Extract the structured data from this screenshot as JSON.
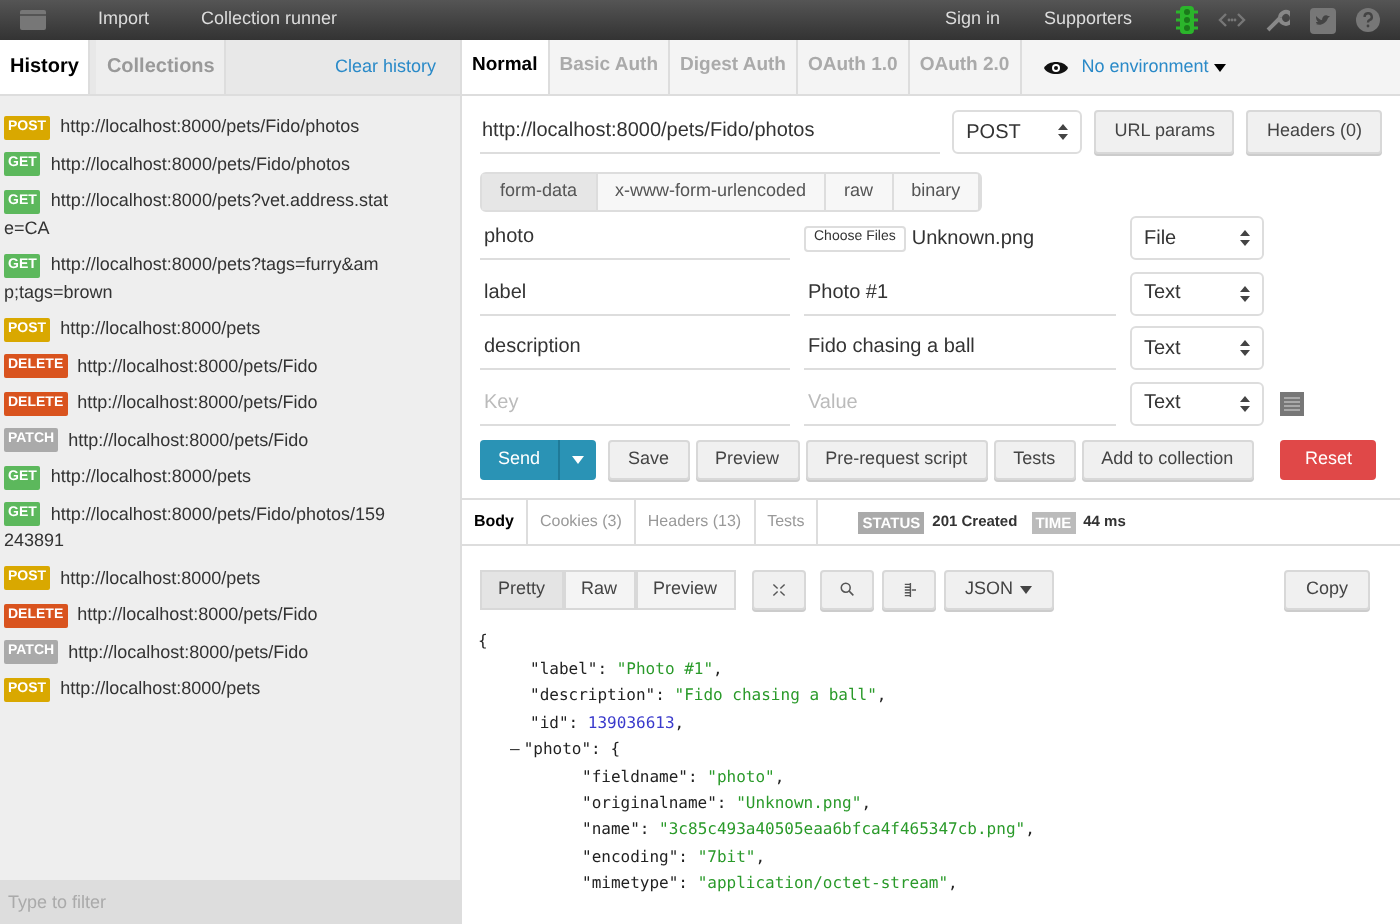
{
  "top_bar": {
    "menu": [
      "Import",
      "Collection runner"
    ],
    "right_links": [
      "Sign in",
      "Supporters"
    ]
  },
  "sidebar": {
    "tabs": [
      {
        "label": "History",
        "selected": true
      },
      {
        "label": "Collections",
        "selected": false
      }
    ],
    "clear_link": "Clear history",
    "history": [
      {
        "method": "POST",
        "color": "#d9a800",
        "url": "http://localhost:8000/pets/Fido/photos"
      },
      {
        "method": "GET",
        "color": "#5cb85c",
        "url": "http://localhost:8000/pets/Fido/photos"
      },
      {
        "method": "GET",
        "color": "#5cb85c",
        "url": "http://localhost:8000/pets?vet.address.state=CA"
      },
      {
        "method": "GET",
        "color": "#5cb85c",
        "url": "http://localhost:8000/pets?tags=furry&amp;tags=brown"
      },
      {
        "method": "POST",
        "color": "#d9a800",
        "url": "http://localhost:8000/pets"
      },
      {
        "method": "DELETE",
        "color": "#d9531e",
        "url": "http://localhost:8000/pets/Fido"
      },
      {
        "method": "DELETE",
        "color": "#d9531e",
        "url": "http://localhost:8000/pets/Fido"
      },
      {
        "method": "PATCH",
        "color": "#aaaaaa",
        "url": "http://localhost:8000/pets/Fido"
      },
      {
        "method": "GET",
        "color": "#5cb85c",
        "url": "http://localhost:8000/pets"
      },
      {
        "method": "GET",
        "color": "#5cb85c",
        "url": "http://localhost:8000/pets/Fido/photos/159243891"
      },
      {
        "method": "POST",
        "color": "#d9a800",
        "url": "http://localhost:8000/pets"
      },
      {
        "method": "DELETE",
        "color": "#d9531e",
        "url": "http://localhost:8000/pets/Fido"
      },
      {
        "method": "PATCH",
        "color": "#aaaaaa",
        "url": "http://localhost:8000/pets/Fido"
      },
      {
        "method": "POST",
        "color": "#d9a800",
        "url": "http://localhost:8000/pets"
      }
    ],
    "filter": {
      "placeholder": "Type to filter"
    }
  },
  "auth_tabs": [
    {
      "label": "Normal",
      "selected": true
    },
    {
      "label": "Basic Auth",
      "selected": false
    },
    {
      "label": "Digest Auth",
      "selected": false
    },
    {
      "label": "OAuth 1.0",
      "selected": false
    },
    {
      "label": "OAuth 2.0",
      "selected": false
    }
  ],
  "environment": "No environment",
  "request": {
    "url": "http://localhost:8000/pets/Fido/photos",
    "method": "POST",
    "buttons": [
      "URL params",
      "Headers (0)"
    ],
    "body_tabs": [
      {
        "label": "form-data",
        "selected": true
      },
      {
        "label": "x-www-form-urlencoded",
        "selected": false
      },
      {
        "label": "raw",
        "selected": false
      },
      {
        "label": "binary",
        "selected": false
      }
    ],
    "form_rows": [
      {
        "kind": "file",
        "key": "photo",
        "file_button": "Choose Files",
        "file_name": "Unknown.png",
        "type": "File"
      },
      {
        "kind": "text",
        "key": "label",
        "value": "Photo #1",
        "type": "Text"
      },
      {
        "kind": "text",
        "key": "description",
        "value": "Fido chasing a ball",
        "type": "Text"
      },
      {
        "kind": "empty",
        "key_placeholder": "Key",
        "value_placeholder": "Value",
        "type": "Text"
      }
    ],
    "send": "Send",
    "actions": [
      "Save",
      "Preview",
      "Pre-request script",
      "Tests",
      "Add to collection"
    ],
    "reset": "Reset"
  },
  "response": {
    "tabs": [
      {
        "label": "Body",
        "selected": true
      },
      {
        "label": "Cookies (3)",
        "selected": false
      },
      {
        "label": "Headers (13)",
        "selected": false
      },
      {
        "label": "Tests",
        "selected": false
      }
    ],
    "status_label": "STATUS",
    "status": "201 Created",
    "time_label": "TIME",
    "time": "44 ms",
    "view_modes": [
      {
        "label": "Pretty",
        "selected": true
      },
      {
        "label": "Raw",
        "selected": false
      },
      {
        "label": "Preview",
        "selected": false
      }
    ],
    "format": "JSON",
    "copy": "Copy",
    "body": {
      "open": "{",
      "lines": [
        {
          "kind": "string",
          "key": "\"label\":",
          "value": "\"Photo #1\"",
          "suffix": ","
        },
        {
          "kind": "string",
          "key": "\"description\":",
          "value": "\"Fido chasing a ball\"",
          "suffix": ","
        },
        {
          "kind": "number",
          "key": "\"id\":",
          "value": "139036613",
          "suffix": ","
        },
        {
          "kind": "object",
          "toggle": "–",
          "key": "\"photo\":",
          "value": "{",
          "children": [
            {
              "kind": "string",
              "key": "\"fieldname\":",
              "value": "\"photo\"",
              "suffix": ","
            },
            {
              "kind": "string",
              "key": "\"originalname\":",
              "value": "\"Unknown.png\"",
              "suffix": ","
            },
            {
              "kind": "string",
              "key": "\"name\":",
              "value": "\"3c85c493a40505eaa6bfca4f465347cb.png\"",
              "suffix": ","
            },
            {
              "kind": "string",
              "key": "\"encoding\":",
              "value": "\"7bit\"",
              "suffix": ","
            },
            {
              "kind": "string",
              "key": "\"mimetype\":",
              "value": "\"application/octet-stream\"",
              "suffix": ","
            }
          ]
        }
      ]
    }
  }
}
